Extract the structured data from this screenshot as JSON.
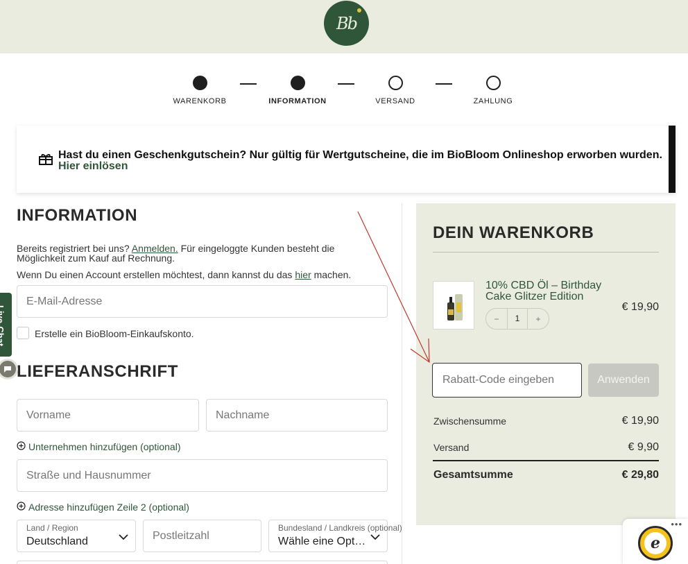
{
  "brand": {
    "logo_text": "Bb",
    "colors": {
      "primary": "#2f5638",
      "panel": "#e9ecdf",
      "accent_dot": "#e2c33a"
    }
  },
  "steps": [
    {
      "label": "WARENKORB",
      "state": "done"
    },
    {
      "label": "INFORMATION",
      "state": "active"
    },
    {
      "label": "VERSAND",
      "state": "pending"
    },
    {
      "label": "ZAHLUNG",
      "state": "pending"
    }
  ],
  "voucher": {
    "icon": "gift-icon",
    "text": "Hast du einen Geschenkgutschein? Nur gültig für Wertgutscheine, die im BioBloom Onlineshop erworben wurden.",
    "link": "Hier einlösen"
  },
  "information": {
    "title": "INFORMATION",
    "registered_pre": "Bereits registriert bei uns?",
    "login_link": "Anmelden.",
    "registered_post": "Für eingeloggte Kunden besteht die",
    "registered_line2": "Möglichkeit zum Kauf auf Rechnung.",
    "account_pre": "Wenn Du einen Account erstellen möchtest, dann kannst du das",
    "account_link": "hier",
    "account_post": "machen.",
    "email_placeholder": "E-Mail-Adresse",
    "create_account_label": "Erstelle ein BioBloom-Einkaufskonto."
  },
  "shipping": {
    "title": "LIEFERANSCHRIFT",
    "first_name_placeholder": "Vorname",
    "last_name_placeholder": "Nachname",
    "add_company": "Unternehmen hinzufügen (optional)",
    "street_placeholder": "Straße und Hausnummer",
    "add_address_line": "Adresse hinzufügen Zeile 2 (optional)",
    "country_label": "Land / Region",
    "country_value": "Deutschland",
    "zip_placeholder": "Postleitzahl",
    "state_label": "Bundesland / Landkreis (optional)",
    "state_value": "Wähle eine Option…"
  },
  "livechat": {
    "label": "Live-Chat"
  },
  "cart": {
    "title": "DEIN WARENKORB",
    "item": {
      "name": "10% CBD Öl – Birthday Cake Glitzer Edition",
      "price": "€ 19,90",
      "qty": "1",
      "minus": "−",
      "plus": "+"
    },
    "discount_placeholder": "Rabatt-Code eingeben",
    "apply_label": "Anwenden",
    "subtotal_label": "Zwischensumme",
    "subtotal_value": "€ 19,90",
    "shipping_label": "Versand",
    "shipping_value": "€ 9,90",
    "total_label": "Gesamtsumme",
    "total_value": "€ 29,80"
  },
  "trusted": {
    "dots": "•••",
    "seal_letter": "e"
  }
}
